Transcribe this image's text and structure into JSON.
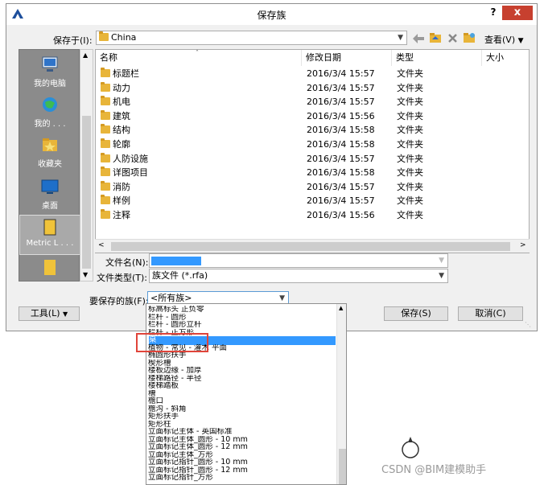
{
  "window": {
    "title": "保存族",
    "help": "?",
    "close": "x"
  },
  "toolbar": {
    "save_in_label": "保存于(I):",
    "save_in_value": "China",
    "view_label": "查看(V)"
  },
  "places": [
    {
      "label": "我的电脑",
      "icon": "computer-icon"
    },
    {
      "label": "我的 . . .",
      "icon": "network-globe-icon"
    },
    {
      "label": "收藏夹",
      "icon": "favorites-folder-icon"
    },
    {
      "label": "桌面",
      "icon": "desktop-icon"
    },
    {
      "label": "Metric L . . .",
      "icon": "library-folder-icon"
    },
    {
      "label": "",
      "icon": "folder-icon"
    }
  ],
  "columns": [
    "名称",
    "修改日期",
    "类型",
    "大小"
  ],
  "files": [
    {
      "name": "标题栏",
      "date": "2016/3/4 15:57",
      "type": "文件夹"
    },
    {
      "name": "动力",
      "date": "2016/3/4 15:57",
      "type": "文件夹"
    },
    {
      "name": "机电",
      "date": "2016/3/4 15:57",
      "type": "文件夹"
    },
    {
      "name": "建筑",
      "date": "2016/3/4 15:56",
      "type": "文件夹"
    },
    {
      "name": "结构",
      "date": "2016/3/4 15:58",
      "type": "文件夹"
    },
    {
      "name": "轮廓",
      "date": "2016/3/4 15:58",
      "type": "文件夹"
    },
    {
      "name": "人防设施",
      "date": "2016/3/4 15:57",
      "type": "文件夹"
    },
    {
      "name": "详图项目",
      "date": "2016/3/4 15:58",
      "type": "文件夹"
    },
    {
      "name": "消防",
      "date": "2016/3/4 15:57",
      "type": "文件夹"
    },
    {
      "name": "样例",
      "date": "2016/3/4 15:57",
      "type": "文件夹"
    },
    {
      "name": "注释",
      "date": "2016/3/4 15:56",
      "type": "文件夹"
    }
  ],
  "form": {
    "filename_label": "文件名(N):",
    "filename_value": "",
    "filetype_label": "文件类型(T):",
    "filetype_value": "族文件 (*.rfa)",
    "family_label": "要保存的族(F):",
    "family_value": "<所有族>"
  },
  "buttons": {
    "tools": "工具(L)",
    "save": "保存(S)",
    "cancel": "取消(C)"
  },
  "family_options": [
    "标高标头 正负零",
    "栏杆 - 圆形",
    "栏杆 - 圆形立杆",
    "栏杆 - 正方形",
    "桌",
    "植物 - 常见 - 灌木 平面",
    "椭圆形扶手",
    "楔形槽",
    "楼板边缘 - 加厚",
    "楼梯路径 - 半径",
    "楼梯踏板",
    "槽",
    "檐口",
    "檐沟 - 斜角",
    "矩形扶手",
    "矩形柱",
    "立面标记主体 - 英国标准",
    "立面标记主体_圆形 - 10 mm",
    "立面标记主体_圆形 - 12 mm",
    "立面标记主体_方形",
    "立面标记指针_圆形 - 10 mm",
    "立面标记指针_圆形 - 12 mm",
    "立面标记指针_方形"
  ],
  "family_selected_index": 4,
  "watermark": "CSDN @BIM建模助手",
  "colors": {
    "selection": "#3399ff",
    "close": "#c7402f",
    "highlight_box": "#e0443a"
  }
}
